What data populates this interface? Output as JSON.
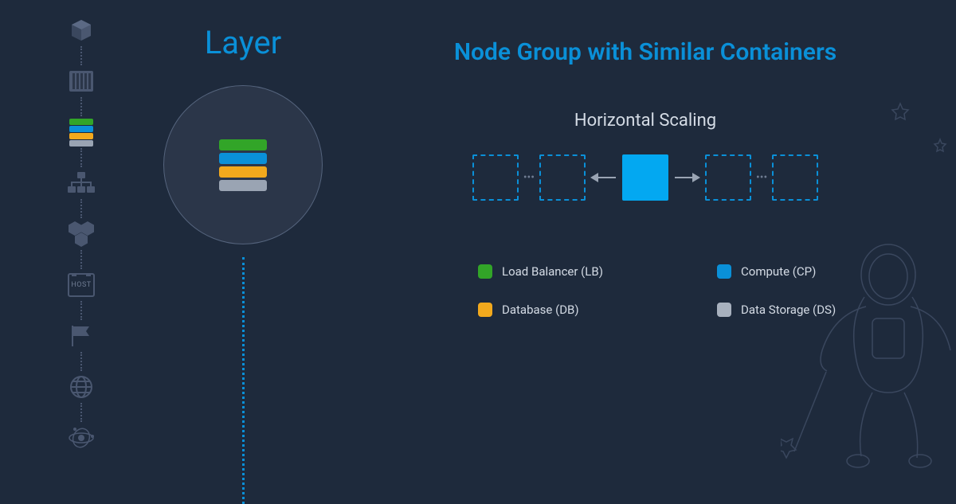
{
  "layer": {
    "title": "Layer"
  },
  "right": {
    "title": "Node Group with Similar Containers",
    "scaling_title": "Horizontal Scaling"
  },
  "legend": {
    "lb": "Load Balancer (LB)",
    "cp": "Compute (CP)",
    "db": "Database (DB)",
    "ds": "Data Storage (DS)"
  },
  "rail": {
    "host_label": "HOST"
  },
  "colors": {
    "accent": "#0a90d8",
    "green": "#32a528",
    "orange": "#f2a91d",
    "grey": "#9aa4b3"
  }
}
